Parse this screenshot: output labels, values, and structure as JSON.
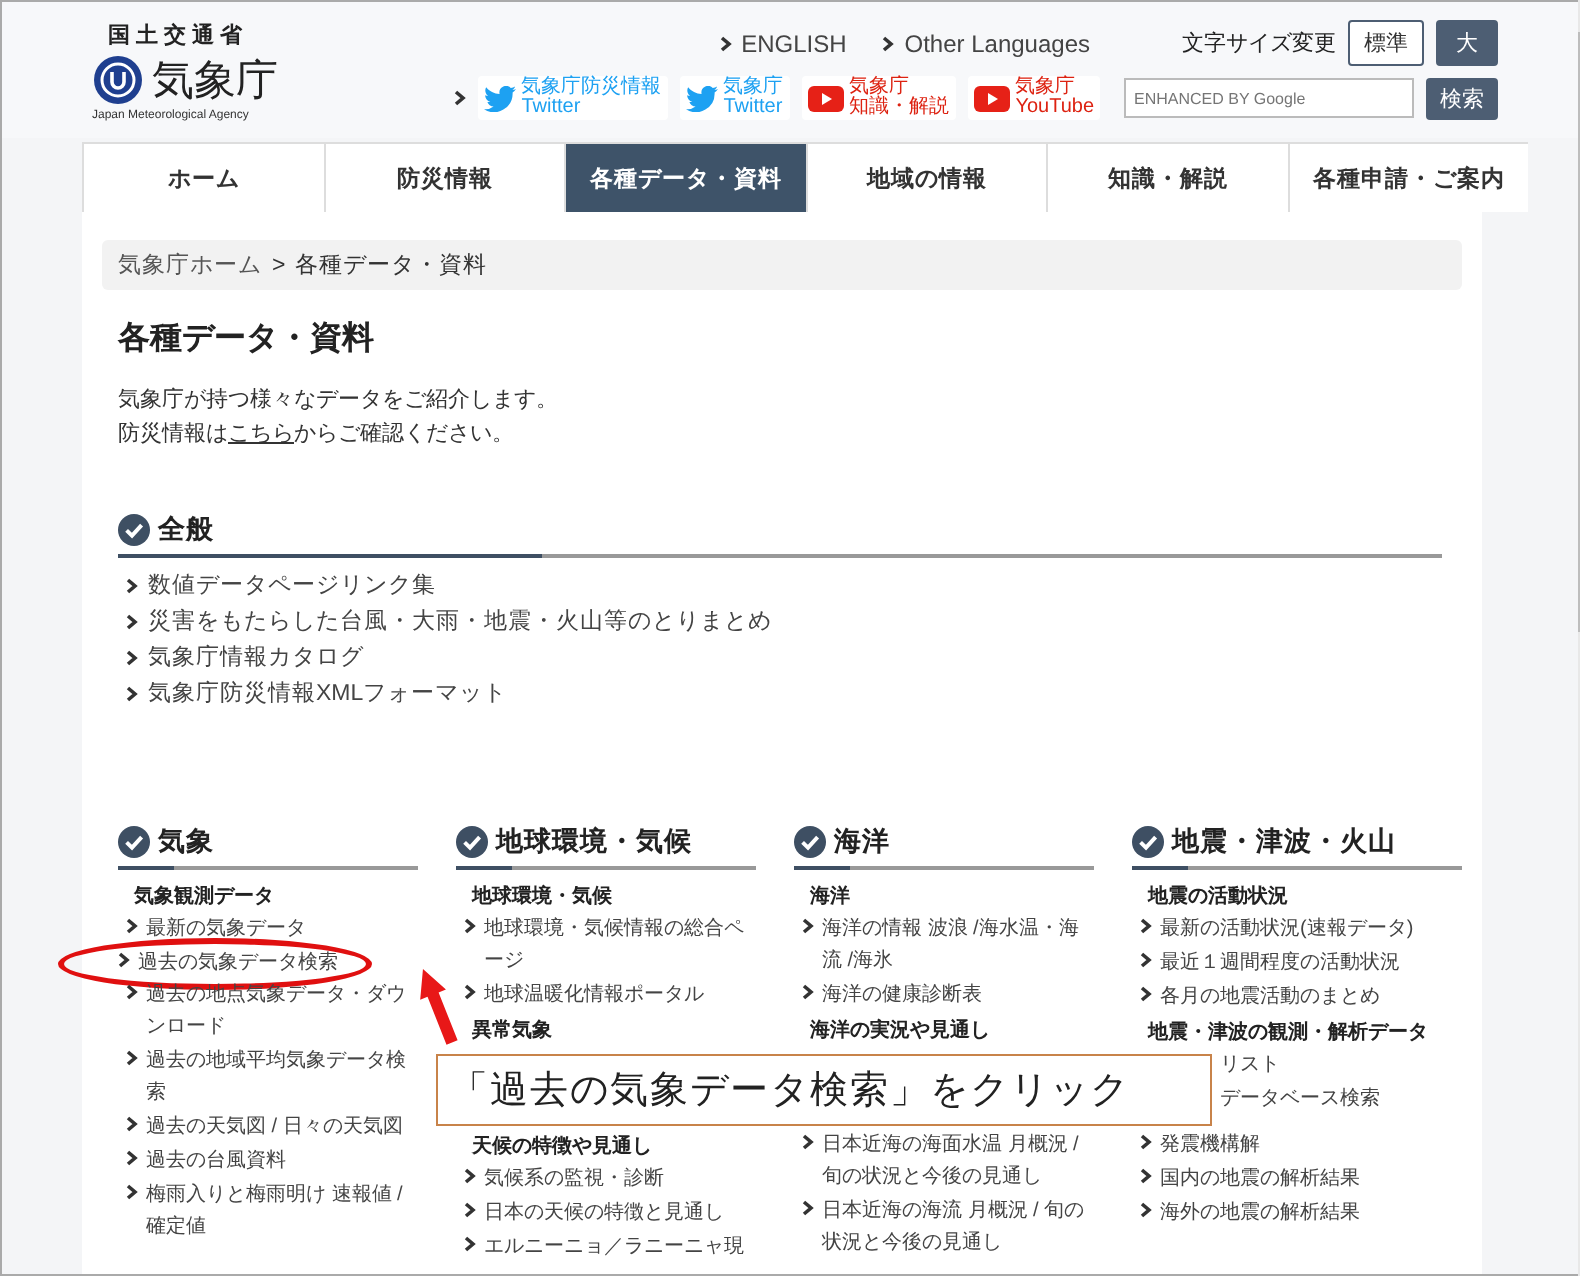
{
  "header": {
    "ministry": "国土交通省",
    "agency": "気象庁",
    "agency_en": "Japan Meteorological Agency",
    "language_links": [
      "ENGLISH",
      "Other Languages"
    ],
    "font_size": {
      "label": "文字サイズ変更",
      "options": [
        {
          "label": "標準",
          "selected": false
        },
        {
          "label": "大",
          "selected": true
        }
      ]
    },
    "social": [
      {
        "kind": "twitter",
        "name": "気象庁防災情報",
        "service": "Twitter"
      },
      {
        "kind": "twitter",
        "name": "気象庁",
        "service": "Twitter"
      },
      {
        "kind": "youtube",
        "name": "気象庁",
        "service": "知識・解説"
      },
      {
        "kind": "youtube",
        "name": "気象庁",
        "service": "YouTube"
      }
    ],
    "search": {
      "placeholder": "ENHANCED BY Google",
      "button": "検索"
    }
  },
  "nav": [
    {
      "label": "ホーム",
      "selected": false
    },
    {
      "label": "防災情報",
      "selected": false
    },
    {
      "label": "各種データ・資料",
      "selected": true
    },
    {
      "label": "地域の情報",
      "selected": false
    },
    {
      "label": "知識・解説",
      "selected": false
    },
    {
      "label": "各種申請・ご案内",
      "selected": false
    }
  ],
  "breadcrumb": {
    "items": [
      "気象庁ホーム",
      "各種データ・資料"
    ],
    "separator": ">"
  },
  "page_title": "各種データ・資料",
  "intro": {
    "line1": "気象庁が持つ様々なデータをご紹介します。",
    "before": "防災情報は",
    "link": "こちら",
    "after": "からご確認ください。"
  },
  "general": {
    "title": "全般",
    "links": [
      "数値データページリンク集",
      "災害をもたらした台風・大雨・地震・火山等のとりまとめ",
      "気象庁情報カタログ",
      "気象庁防災情報XMLフォーマット"
    ]
  },
  "categories": [
    {
      "title": "気象",
      "entries": [
        {
          "kind": "subheading",
          "text": "気象観測データ"
        },
        {
          "kind": "link",
          "text": "最新の気象データ",
          "highlighted": false
        },
        {
          "kind": "link",
          "text": "過去の気象データ検索",
          "highlighted": true
        },
        {
          "kind": "link",
          "text": "過去の地点気象データ・ダウンロード",
          "highlighted": false
        },
        {
          "kind": "link",
          "text": "過去の地域平均気象データ検索",
          "highlighted": false
        },
        {
          "kind": "link",
          "text": "過去の天気図 / 日々の天気図",
          "highlighted": false
        },
        {
          "kind": "link",
          "text": "過去の台風資料",
          "highlighted": false
        },
        {
          "kind": "link",
          "text": "梅雨入りと梅雨明け 速報値 / 確定値",
          "highlighted": false
        }
      ]
    },
    {
      "title": "地球環境・気候",
      "entries": [
        {
          "kind": "subheading",
          "text": "地球環境・気候"
        },
        {
          "kind": "link",
          "text": "地球環境・気候情報の総合ページ",
          "highlighted": false
        },
        {
          "kind": "link",
          "text": "地球温暖化情報ポータル",
          "highlighted": false
        },
        {
          "kind": "subheading",
          "text": "異常気象"
        },
        {
          "kind": "covered"
        },
        {
          "kind": "subheading",
          "text": "天候の特徴や見通し"
        },
        {
          "kind": "link",
          "text": "気候系の監視・診断",
          "highlighted": false
        },
        {
          "kind": "link",
          "text": "日本の天候の特徴と見通し",
          "highlighted": false
        },
        {
          "kind": "link",
          "text": "エルニーニョ／ラニーニャ現",
          "highlighted": false
        }
      ]
    },
    {
      "title": "海洋",
      "entries": [
        {
          "kind": "subheading",
          "text": "海洋"
        },
        {
          "kind": "link",
          "text": "海洋の情報 波浪 /海水温・海流 /海氷",
          "highlighted": false
        },
        {
          "kind": "link",
          "text": "海洋の健康診断表",
          "highlighted": false
        },
        {
          "kind": "subheading",
          "text": "海洋の実況や見通し"
        },
        {
          "kind": "covered"
        },
        {
          "kind": "link",
          "text": "日本近海の海面水温 月概況 / 旬の状況と今後の見通し",
          "highlighted": false
        },
        {
          "kind": "link",
          "text": "日本近海の海流 月概況 / 旬の状況と今後の見通し",
          "highlighted": false
        }
      ]
    },
    {
      "title": "地震・津波・火山",
      "entries": [
        {
          "kind": "subheading",
          "text": "地震の活動状況"
        },
        {
          "kind": "link",
          "text": "最新の活動状況(速報データ)",
          "highlighted": false
        },
        {
          "kind": "link",
          "text": "最近１週間程度の活動状況",
          "highlighted": false
        },
        {
          "kind": "link",
          "text": "各月の地震活動のまとめ",
          "highlighted": false
        },
        {
          "kind": "subheading",
          "text": "地震・津波の観測・解析データ"
        },
        {
          "kind": "partial",
          "text": "リスト"
        },
        {
          "kind": "partial",
          "text": "データベース検索"
        },
        {
          "kind": "link",
          "text": "発震機構解",
          "highlighted": false
        },
        {
          "kind": "link",
          "text": "国内の地震の解析結果",
          "highlighted": false
        },
        {
          "kind": "link",
          "text": "海外の地震の解析結果",
          "highlighted": false
        }
      ]
    }
  ],
  "annotation": {
    "callout": "「過去の気象データ検索」をクリック"
  }
}
